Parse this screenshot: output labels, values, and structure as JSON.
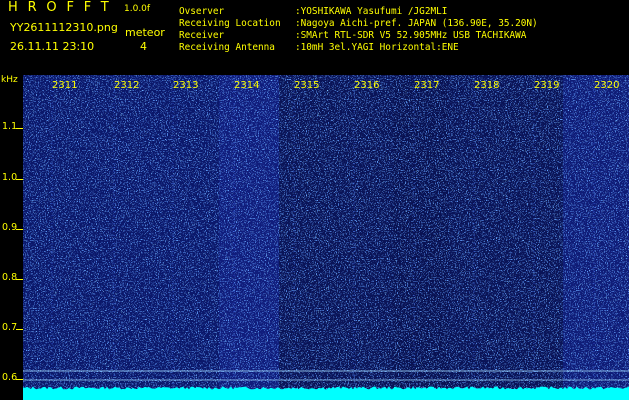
{
  "header": {
    "app_title": "HROFFT",
    "version": "1.0.0f",
    "filename": "YY2611112310.png",
    "meteor_label": "meteor",
    "meteor_count": "4",
    "datetime": "26.11.11 23:10"
  },
  "info": [
    {
      "key": "Ovserver",
      "value": ":YOSHIKAWA Yasufumi /JG2MLI"
    },
    {
      "key": "Receiving Location",
      "value": ":Nagoya Aichi-pref. JAPAN (136.90E, 35.20N)"
    },
    {
      "key": "Receiver",
      "value": ":SMArt RTL-SDR V5 52.905MHz USB TACHIKAWA"
    },
    {
      "key": "Receiving Antenna",
      "value": ":10mH 3el.YAGI Horizontal:ENE"
    }
  ],
  "axis": {
    "unit": "kHz",
    "ticks": [
      "1.1",
      "1.0",
      "0.9",
      "0.8",
      "0.7",
      "0.6"
    ]
  },
  "minutes": [
    "2311",
    "2312",
    "2313",
    "2314",
    "2315",
    "2316",
    "2317",
    "2318",
    "2319",
    "2320"
  ],
  "colors": {
    "label": "#ffff00",
    "background": "#000000",
    "plot_bg": "#0a1458",
    "noise_floor": "#00ffff"
  }
}
